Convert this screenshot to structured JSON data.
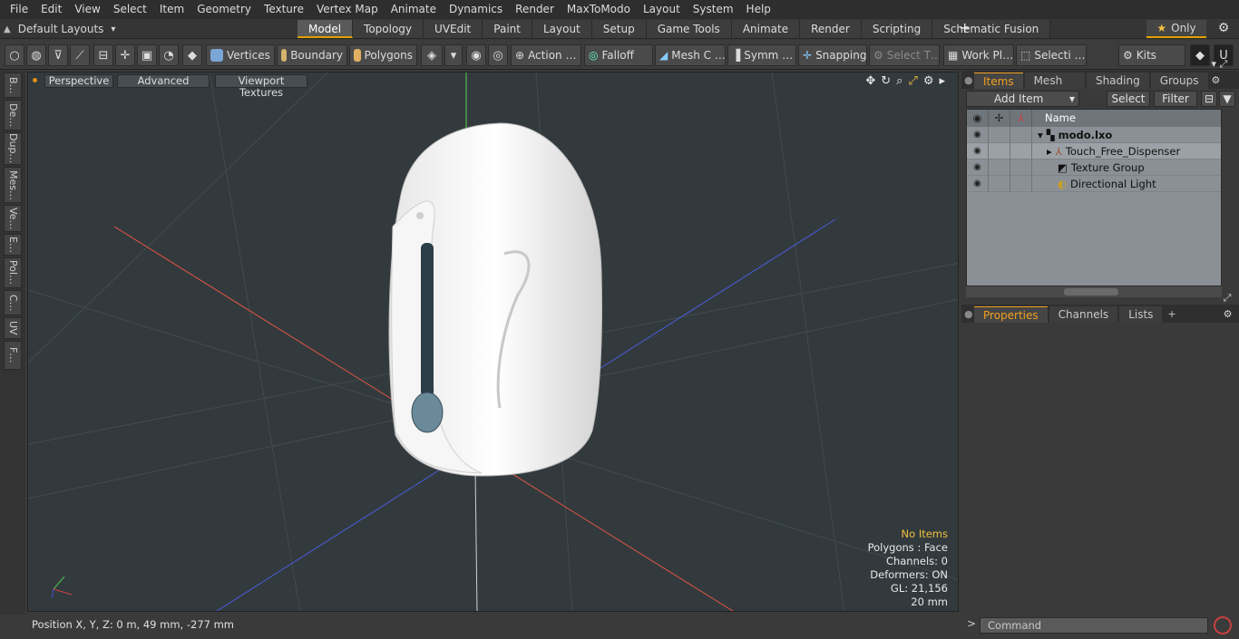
{
  "menu": [
    "File",
    "Edit",
    "View",
    "Select",
    "Item",
    "Geometry",
    "Texture",
    "Vertex Map",
    "Animate",
    "Dynamics",
    "Render",
    "MaxToModo",
    "Layout",
    "System",
    "Help"
  ],
  "layout_selector": {
    "label": "Default Layouts",
    "arrow": "▾"
  },
  "tabs": [
    "Model",
    "Topology",
    "UVEdit",
    "Paint",
    "Layout",
    "Setup",
    "Game Tools",
    "Animate",
    "Render",
    "Scripting",
    "Schematic Fusion"
  ],
  "tab_add": "+",
  "only_button": {
    "star": "★",
    "label": "Only"
  },
  "toolbar": {
    "vertices": "Vertices",
    "boundary": "Boundary",
    "polygons": "Polygons",
    "action": "Action …",
    "falloff": "Falloff",
    "mesh": "Mesh C …",
    "symm": "Symm …",
    "snapping": "Snapping",
    "select_t": "Select T…",
    "workpl": "Work Pl…",
    "selecti": "Selecti …",
    "kits": "Kits"
  },
  "left_tabs": [
    "B…",
    "De…",
    "Dup…",
    "Mes…",
    "Ve…",
    "E…",
    "Pol…",
    "C…",
    "UV",
    "F…"
  ],
  "viewport": {
    "perspective": "Perspective",
    "advanced": "Advanced",
    "textures": "Viewport Textures",
    "stats": [
      "No Items",
      "Polygons : Face",
      "Channels: 0",
      "Deformers: ON",
      "GL: 21,156",
      "20 mm"
    ]
  },
  "status": {
    "position": "Position X, Y, Z:   0 m, 49 mm, -277 mm"
  },
  "items_panel": {
    "tabs": [
      "Items",
      "Mesh …",
      "Shading",
      "Groups"
    ],
    "add_item": "Add Item",
    "select": "Select",
    "filter": "Filter",
    "name_header": "Name",
    "rows": [
      {
        "label": "modo.lxo",
        "bold": true
      },
      {
        "label": "Touch_Free_Dispenser",
        "bold": false
      },
      {
        "label": "Texture Group",
        "bold": false
      },
      {
        "label": "Directional Light",
        "bold": false
      }
    ]
  },
  "props_panel": {
    "tabs": [
      "Properties",
      "Channels",
      "Lists"
    ],
    "add": "+"
  },
  "command": {
    "placeholder": "Command",
    "chevron": ">"
  }
}
